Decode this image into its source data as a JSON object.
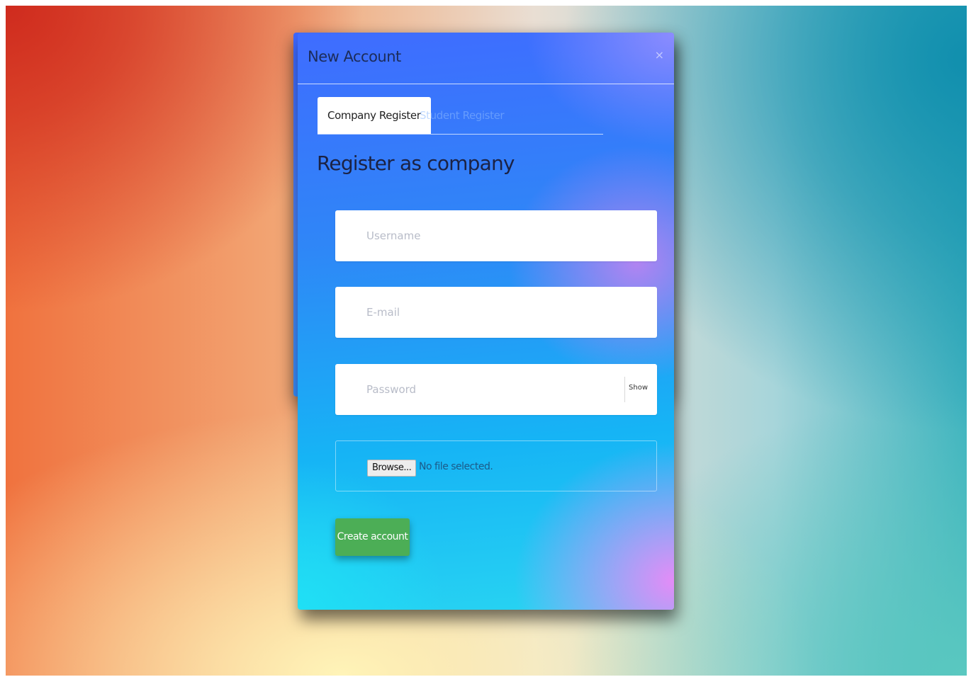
{
  "modal": {
    "title": "New Account",
    "close_label": "×"
  },
  "tabs": [
    {
      "label": "Company Register",
      "active": true
    },
    {
      "label": "Student Register",
      "active": false
    }
  ],
  "form": {
    "heading": "Register as company",
    "username": {
      "placeholder": "Username",
      "value": ""
    },
    "email": {
      "placeholder": "E-mail",
      "value": ""
    },
    "password": {
      "placeholder": "Password",
      "value": "",
      "show_label": "Show"
    },
    "file": {
      "browse_label": "Browse...",
      "status": "No file selected."
    },
    "submit_label": "Create account"
  },
  "colors": {
    "submit_button": "#4cae56",
    "modal_top": "#3f6cff",
    "modal_bottom": "#28d4f2"
  }
}
